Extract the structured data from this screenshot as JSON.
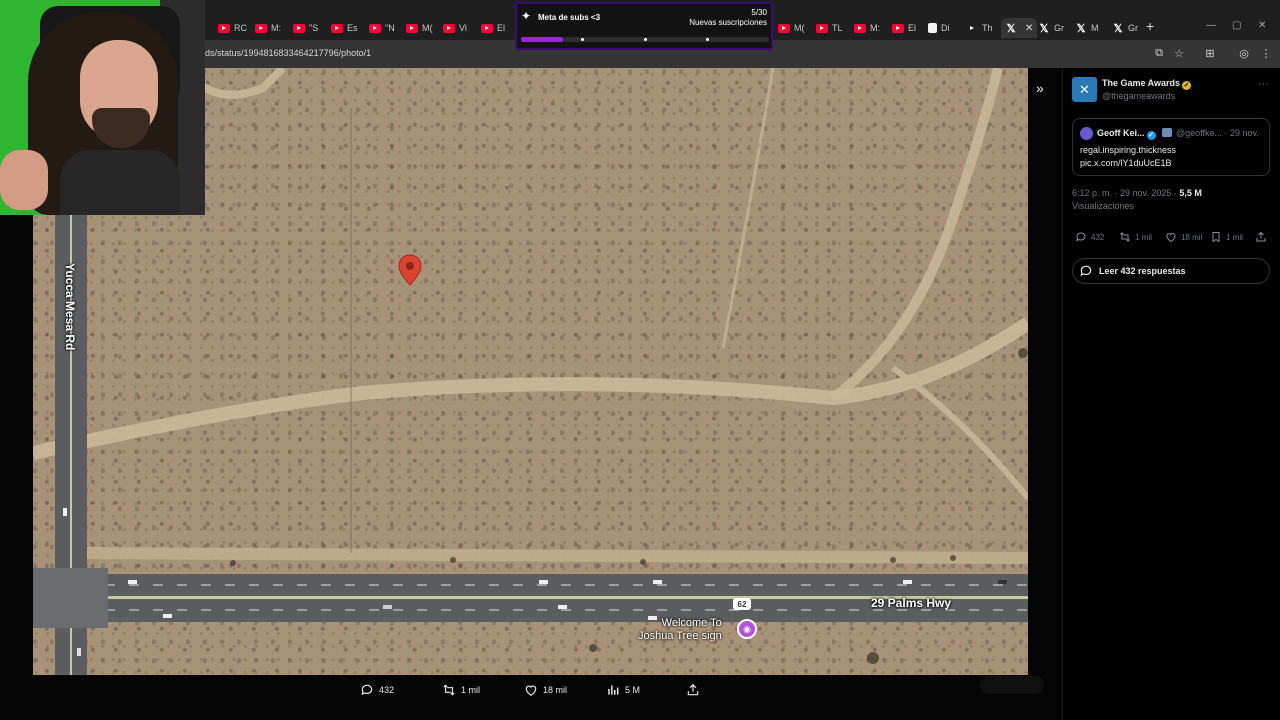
{
  "browser": {
    "tabs": [
      {
        "label": "RC",
        "icon": "youtube-icon"
      },
      {
        "label": "M:",
        "icon": "youtube-icon"
      },
      {
        "label": "\"S",
        "icon": "youtube-icon"
      },
      {
        "label": "Es",
        "icon": "youtube-icon"
      },
      {
        "label": "\"N",
        "icon": "youtube-icon"
      },
      {
        "label": "M(",
        "icon": "youtube-icon"
      },
      {
        "label": "Vi",
        "icon": "youtube-icon"
      },
      {
        "label": "El",
        "icon": "youtube-icon"
      },
      {
        "label": "M(",
        "icon": "youtube-icon"
      },
      {
        "label": "TL",
        "icon": "youtube-icon"
      },
      {
        "label": "M:",
        "icon": "youtube-icon"
      },
      {
        "label": "El",
        "icon": "youtube-icon"
      },
      {
        "label": "Di",
        "icon": "doc-icon"
      },
      {
        "label": "Th",
        "icon": "blank-icon"
      },
      {
        "label": "",
        "icon": "x-logo-icon",
        "active": true
      },
      {
        "label": "Gr",
        "icon": "x-logo-icon"
      },
      {
        "label": "M",
        "icon": "x-logo-icon"
      },
      {
        "label": "Gr",
        "icon": "x-logo-icon"
      }
    ],
    "new_tab": "+",
    "url": "ds/status/1994816833464217796/photo/1"
  },
  "sub_goal": {
    "title": "Meta de subs <3",
    "count": "5/30",
    "label": "Nuevas suscripciones",
    "progress": 0.17,
    "accent": "#9d23d8"
  },
  "map": {
    "labels": {
      "side_road": "Yucca Mesa Rd",
      "highway": "29 Palms Hwy",
      "highway_shield": "62",
      "poi": "Welcome To\nJoshua Tree sign"
    },
    "pin_color": "#d9432f"
  },
  "actions": {
    "replies": "432",
    "reposts": "1 mil",
    "likes": "18 mil",
    "views": "5 M"
  },
  "tweet": {
    "account_name": "The Game Awards",
    "account_handle": "@thegameawards",
    "quote": {
      "name": "Geoff Kei...",
      "handle": "@geoffke... · 29 nov.",
      "text_line1": "regal.inspiring.thickness",
      "text_line2": "pic.x.com/lY1duUcE1B"
    },
    "timestamp": "6:12 p. m. · 29 nov. 2025 · ",
    "views_count": "5,5 M",
    "views_label": "Visualizaciones",
    "stats": {
      "replies": "432",
      "reposts": "1 mil",
      "likes": "18 mil",
      "bookmarks": "1 mil"
    },
    "read_replies": "Leer 432 respuestas"
  }
}
